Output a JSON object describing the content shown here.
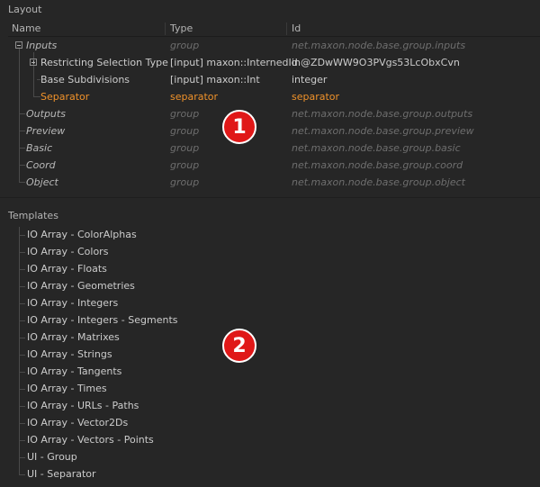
{
  "layout": {
    "label": "Layout",
    "columns": {
      "name": "Name",
      "type": "Type",
      "id": "Id"
    },
    "rows": [
      {
        "name": "Inputs",
        "type": "group",
        "id": "net.maxon.node.base.group.inputs"
      },
      {
        "name": "Restricting Selection Type",
        "type": "[input] maxon::InternedId",
        "id": "in@ZDwWW9O3PVgs53LcObxCvn"
      },
      {
        "name": "Base Subdivisions",
        "type": "[input] maxon::Int",
        "id": "integer"
      },
      {
        "name": "Separator",
        "type": "separator",
        "id": "separator"
      },
      {
        "name": "Outputs",
        "type": "group",
        "id": "net.maxon.node.base.group.outputs"
      },
      {
        "name": "Preview",
        "type": "group",
        "id": "net.maxon.node.base.group.preview"
      },
      {
        "name": "Basic",
        "type": "group",
        "id": "net.maxon.node.base.group.basic"
      },
      {
        "name": "Coord",
        "type": "group",
        "id": "net.maxon.node.base.group.coord"
      },
      {
        "name": "Object",
        "type": "group",
        "id": "net.maxon.node.base.group.object"
      }
    ]
  },
  "templates": {
    "label": "Templates",
    "items": [
      "IO Array - ColorAlphas",
      "IO Array - Colors",
      "IO Array - Floats",
      "IO Array - Geometries",
      "IO Array - Integers",
      "IO Array - Integers - Segments",
      "IO Array - Matrixes",
      "IO Array - Strings",
      "IO Array - Tangents",
      "IO Array - Times",
      "IO Array - URLs - Paths",
      "IO Array - Vector2Ds",
      "IO Array - Vectors - Points",
      "UI - Group",
      "UI - Separator"
    ]
  },
  "annotations": {
    "badge1": "1",
    "badge2": "2",
    "color": "#e01818"
  },
  "colors": {
    "background": "#262626",
    "selected": "#f0922a",
    "dim": "#6e6e6e"
  }
}
